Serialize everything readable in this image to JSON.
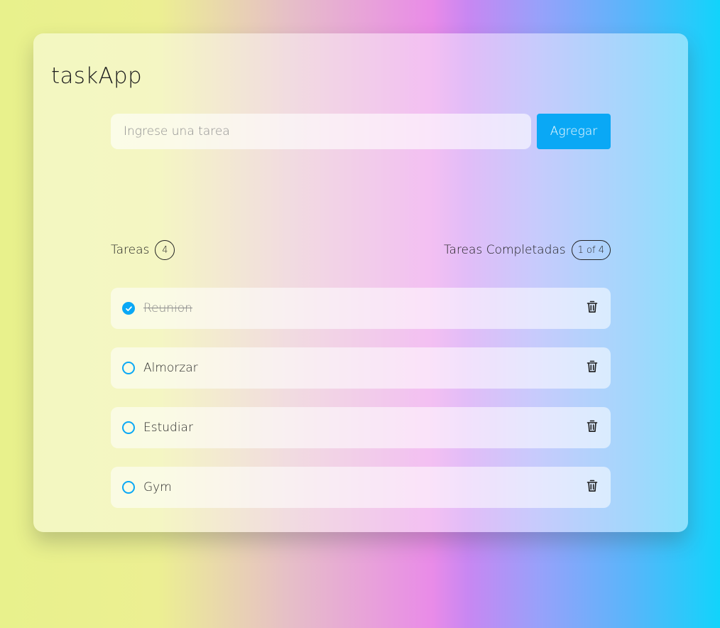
{
  "app": {
    "title": "taskApp"
  },
  "form": {
    "placeholder": "Ingrese una tarea",
    "value": "",
    "add_label": "Agregar"
  },
  "summary": {
    "tasks_label": "Tareas",
    "tasks_count": "4",
    "completed_label": "Tareas Completadas",
    "completed_count": "1 of 4"
  },
  "tasks": [
    {
      "label": "Reunion",
      "completed": true,
      "icon": "trash-icon"
    },
    {
      "label": "Almorzar",
      "completed": false,
      "icon": "trash-icon"
    },
    {
      "label": "Estudiar",
      "completed": false,
      "icon": "trash-icon"
    },
    {
      "label": "Gym",
      "completed": false,
      "icon": "trash-icon"
    }
  ],
  "colors": {
    "accent": "#0aa8f5",
    "text": "#1d1d1d"
  }
}
